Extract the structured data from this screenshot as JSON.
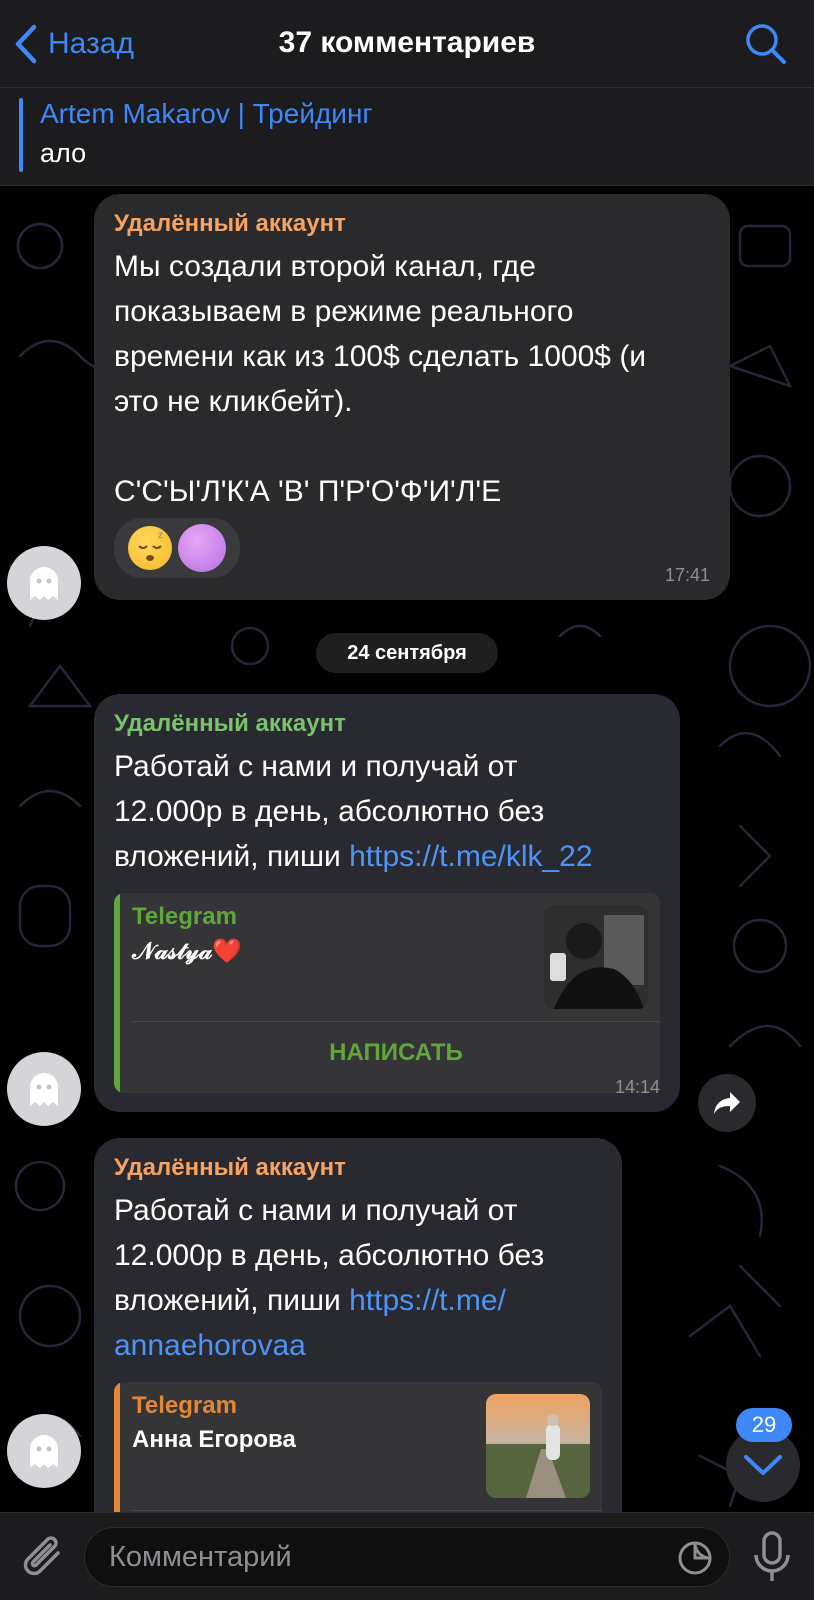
{
  "header": {
    "back_label": "Назад",
    "title": "37 комментариев"
  },
  "pinned": {
    "title": "Artem Makarov | Трейдинг",
    "text": "ало"
  },
  "messages": [
    {
      "sender": "Удалённый аккаунт",
      "sender_color": "#f7a363",
      "text": "Мы создали второй канал, где\nпоказываем в режиме реального\nвремени как из 100$ сделать 1000$ (и\nэто не кликбейт).\n\nС'С'Ы'Л'К'А 'В' П'Р'О'Ф'И'Л'Е",
      "reactions": [
        "sleeping-face-emoji",
        "purple-circle-emoji"
      ],
      "time": "17:41"
    },
    {
      "sender": "Удалённый аккаунт",
      "sender_color": "#7ac36a",
      "text": "Работай с нами и получай от\n12.000р в день, абсолютно без\nвложений, пиши ",
      "link": "https://t.me/klk_22",
      "preview": {
        "site": "Telegram",
        "title": "𝒩𝒶𝓈𝓉𝓎𝒶❤️",
        "action": "НАПИСАТЬ",
        "accent": "#5fa73a"
      },
      "time": "14:14"
    },
    {
      "sender": "Удалённый аккаунт",
      "sender_color": "#f7a363",
      "text": "Работай с нами и получай от\n12.000р в день, абсолютно без\nвложений, пиши ",
      "link": "https://t.me/\nannaehorovaa",
      "preview": {
        "site": "Telegram",
        "title": "Анна Егорова",
        "accent": "#e08838"
      }
    }
  ],
  "date_separator": "24 сентября",
  "unread_badge": "29",
  "composer": {
    "placeholder": "Комментарий"
  },
  "colors": {
    "accent": "#3e88f7",
    "bubble": "#2a2a2c",
    "background": "#000000"
  }
}
